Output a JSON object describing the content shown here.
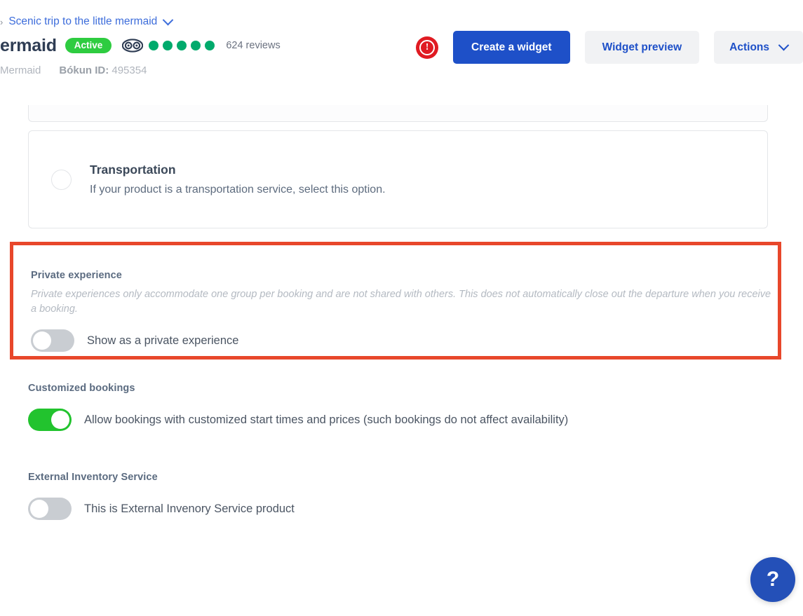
{
  "header": {
    "breadcrumb": {
      "caret": "›",
      "link_label": "Scenic trip to the little mermaid",
      "chevron_icon": "chevron-down-icon"
    },
    "product_title": "ermaid",
    "status_badge": "Active",
    "tripadvisor": {
      "icon": "tripadvisor-owl-icon",
      "rating_dots": 5,
      "dot_color": "#00aa6c",
      "reviews_text": "624 reviews"
    },
    "supplier": "Mermaid",
    "bokun_id_label": "Bókun ID:",
    "bokun_id_value": "495354",
    "alert_icon": "alert-exclamation-icon",
    "buttons": {
      "create_widget": "Create a widget",
      "widget_preview": "Widget preview",
      "actions": "Actions"
    },
    "colors": {
      "primary": "#1e50c8",
      "secondary_bg": "#f1f2f4",
      "badge_green": "#2ecc40",
      "alert_red": "#e01b22"
    }
  },
  "main": {
    "transportation": {
      "title": "Transportation",
      "description": "If your product is a transportation service, select this option.",
      "radio_selected": false
    },
    "private_experience": {
      "label": "Private experience",
      "description": "Private experiences only accommodate one group per booking and are not shared with others. This does not automatically close out the departure when you receive a booking.",
      "toggle_label": "Show as a private experience",
      "toggle_on": false,
      "highlight_color": "#e8472b"
    },
    "customized_bookings": {
      "label": "Customized bookings",
      "toggle_label": "Allow bookings with customized start times and prices (such bookings do not affect availability)",
      "toggle_on": true,
      "toggle_on_color": "#22c32e"
    },
    "external_inventory_service": {
      "label": "External Inventory Service",
      "toggle_label": "This is External Invenory Service product",
      "toggle_on": false
    }
  },
  "help": {
    "label": "?",
    "icon": "question-mark-icon",
    "color": "#2450b8"
  }
}
